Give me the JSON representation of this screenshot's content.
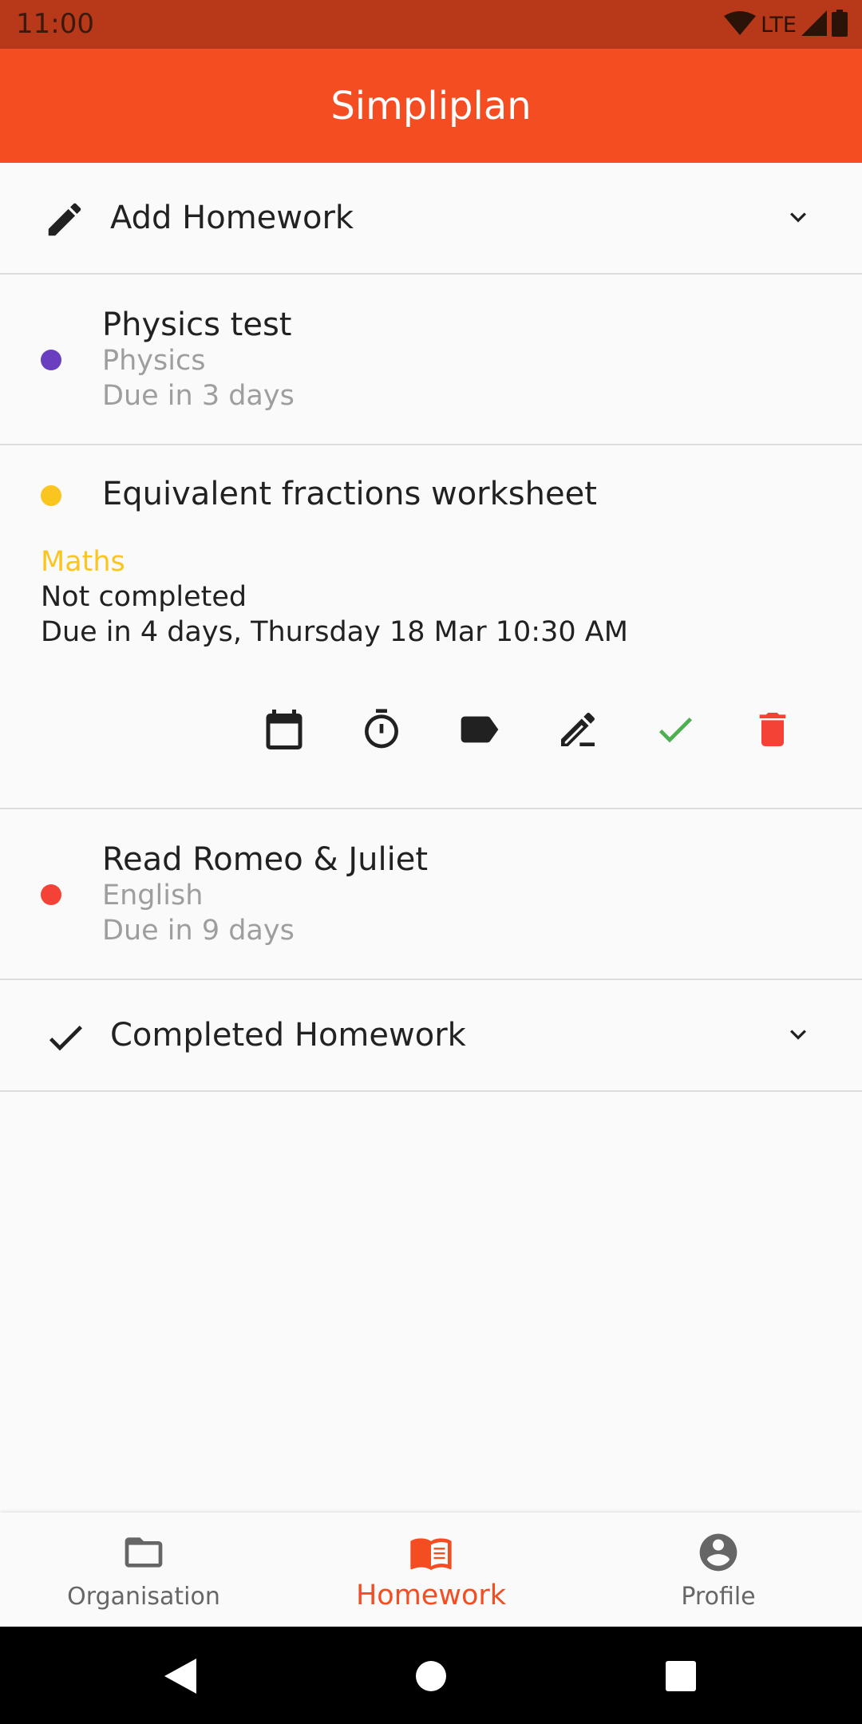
{
  "status_bar": {
    "time": "11:00",
    "network": "LTE"
  },
  "app_bar": {
    "title": "Simpliplan"
  },
  "add_section": {
    "label": "Add Homework",
    "icon": "pencil-icon"
  },
  "homework": [
    {
      "title": "Physics test",
      "subject": "Physics",
      "due": "Due in 3 days",
      "color": "#6a3fbf"
    },
    {
      "title": "Equivalent fractions worksheet",
      "subject": "Maths",
      "status": "Not completed",
      "due": "Due in 4 days, Thursday 18 Mar 10:30 AM",
      "color": "#fbc520",
      "expanded": true,
      "actions": [
        "calendar-icon",
        "timer-icon",
        "label-icon",
        "edit-icon",
        "check-icon",
        "delete-icon"
      ]
    },
    {
      "title": "Read Romeo & Juliet",
      "subject": "English",
      "due": "Due in 9 days",
      "color": "#f44336"
    }
  ],
  "completed_section": {
    "label": "Completed Homework",
    "icon": "check-icon"
  },
  "bottom_nav": [
    {
      "label": "Organisation",
      "icon": "folder-icon",
      "active": false
    },
    {
      "label": "Homework",
      "icon": "book-icon",
      "active": true
    },
    {
      "label": "Profile",
      "icon": "account-circle-icon",
      "active": false
    }
  ],
  "colors": {
    "accent": "#f44d22",
    "status_bar": "#b7391a",
    "check": "#4caf50",
    "delete": "#f44336"
  }
}
